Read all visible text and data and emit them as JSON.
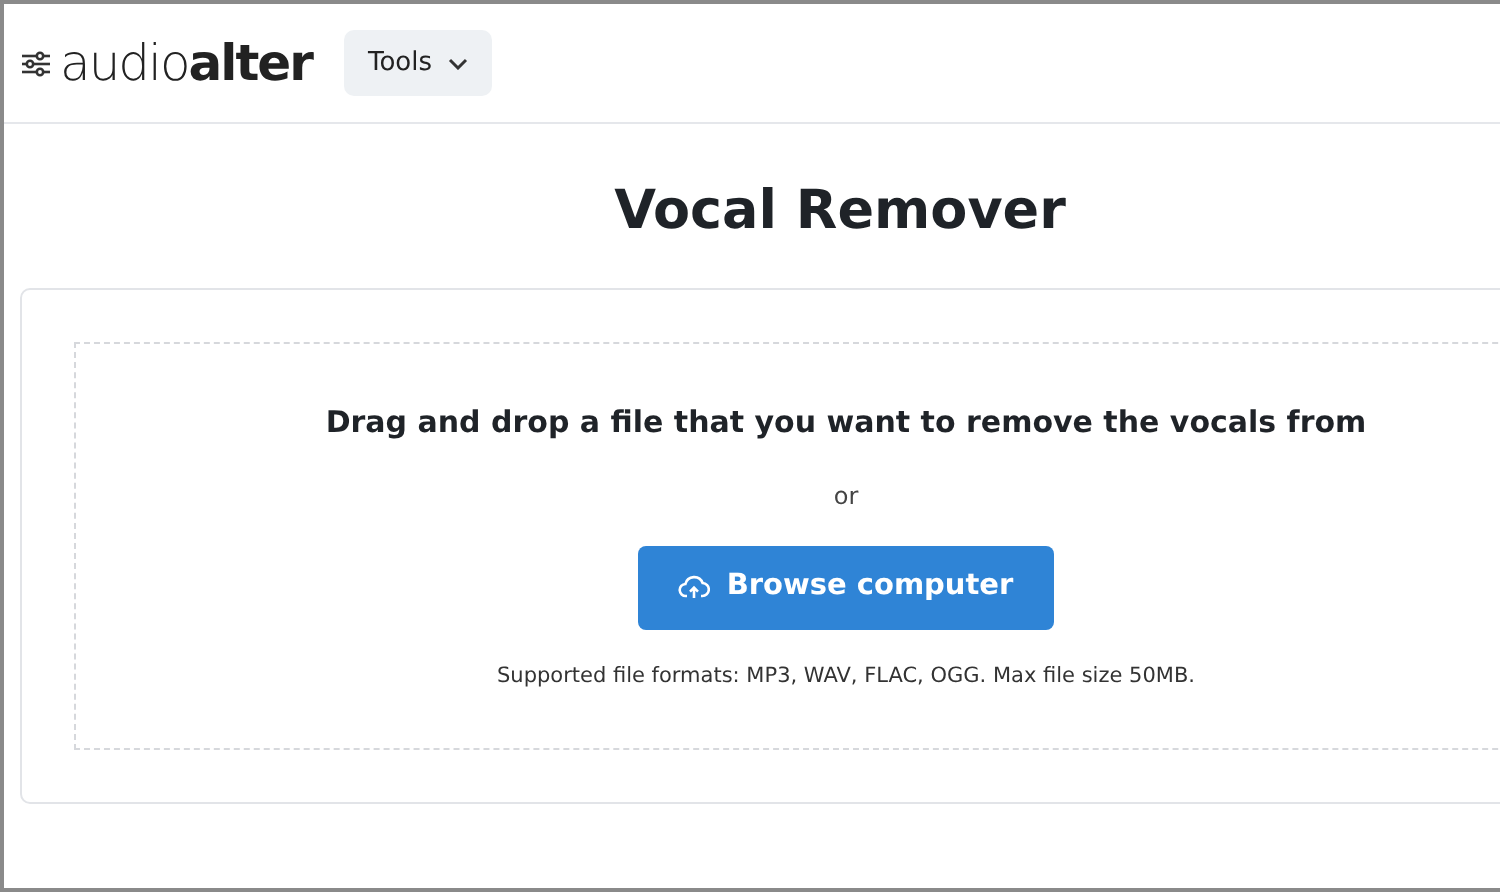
{
  "header": {
    "logo": "audio**alter**",
    "menu_button": "Tools"
  },
  "title": "Vocal Remover",
  "upload": {
    "prompt": "Drag and drop a file that you want to remove the vocals from",
    "separator": "or",
    "button": "Browse computer",
    "note": "Supported file formats: MP3, WAV, FLAC, OGG. Max file size 50MB."
  }
}
